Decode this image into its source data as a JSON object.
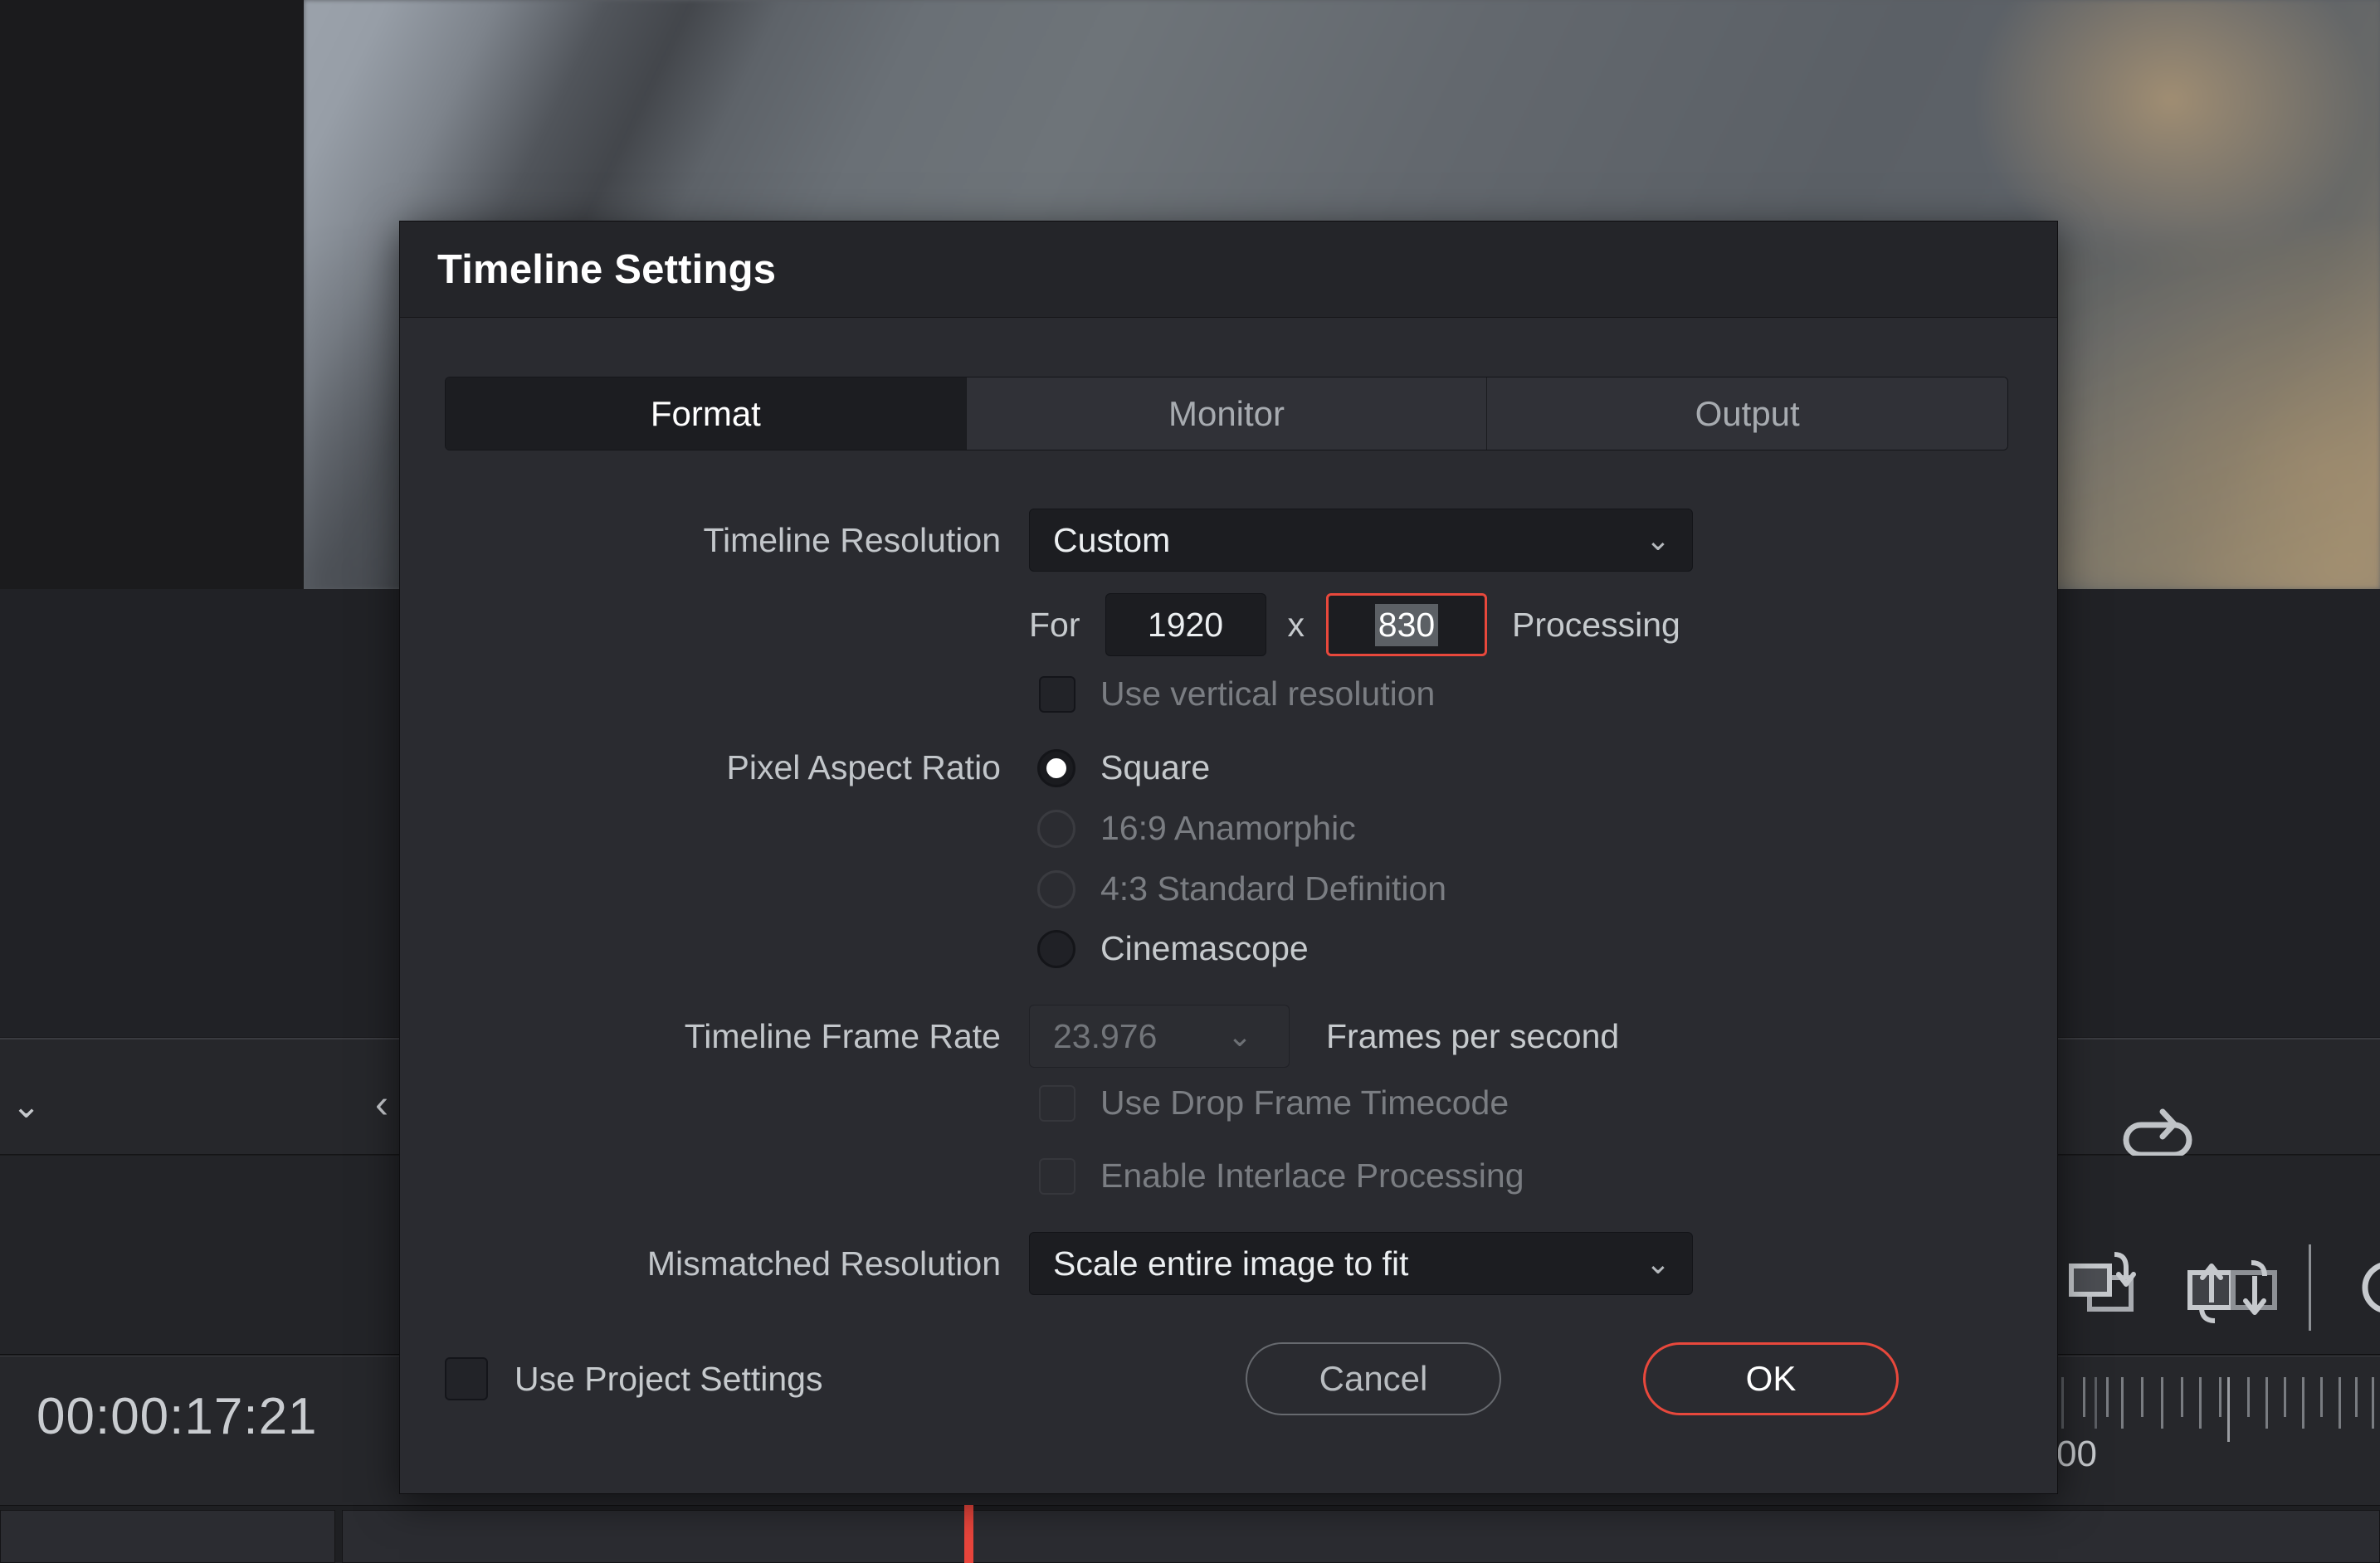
{
  "background": {
    "timecode": "00:00:17:21",
    "ruler_label": "00",
    "icons": {
      "chevron_down": "chevron-down-icon",
      "chevron_left": "chevron-left-icon",
      "loop": "loop-icon",
      "insert_clip": "insert-clip-icon",
      "swap_clip": "swap-clip-icon",
      "marker": "marker-icon"
    }
  },
  "dialog": {
    "title": "Timeline Settings",
    "tabs": [
      {
        "label": "Format",
        "active": true
      },
      {
        "label": "Monitor",
        "active": false
      },
      {
        "label": "Output",
        "active": false
      }
    ],
    "fields": {
      "timeline_resolution": {
        "label": "Timeline Resolution",
        "value": "Custom",
        "caret": "chevron-down-icon"
      },
      "custom_resolution": {
        "prefix": "For",
        "width": "1920",
        "separator": "x",
        "height": "830",
        "suffix": "Processing"
      },
      "use_vertical_resolution": {
        "label": "Use vertical resolution",
        "checked": false,
        "enabled": true
      },
      "pixel_aspect_ratio": {
        "label": "Pixel Aspect Ratio",
        "options": [
          {
            "label": "Square",
            "selected": true,
            "enabled": true
          },
          {
            "label": "16:9 Anamorphic",
            "selected": false,
            "enabled": false
          },
          {
            "label": "4:3 Standard Definition",
            "selected": false,
            "enabled": false
          },
          {
            "label": "Cinemascope",
            "selected": false,
            "enabled": true
          }
        ]
      },
      "timeline_frame_rate": {
        "label": "Timeline Frame Rate",
        "value": "23.976",
        "suffix": "Frames per second",
        "enabled": false
      },
      "use_drop_frame_timecode": {
        "label": "Use Drop Frame Timecode",
        "checked": false,
        "enabled": false
      },
      "enable_interlace_processing": {
        "label": "Enable Interlace Processing",
        "checked": false,
        "enabled": false
      },
      "mismatched_resolution": {
        "label": "Mismatched Resolution",
        "value": "Scale entire image to fit",
        "caret": "chevron-down-icon"
      },
      "use_project_settings": {
        "label": "Use Project Settings",
        "checked": false
      }
    },
    "buttons": {
      "cancel": "Cancel",
      "ok": "OK"
    },
    "colors": {
      "accent": "#e8483c",
      "dialog_bg": "#2a2b30",
      "titlebar_bg": "#242529",
      "field_bg": "#1c1d21",
      "text": "#c6cacd",
      "text_dim": "#7a7d82"
    }
  }
}
